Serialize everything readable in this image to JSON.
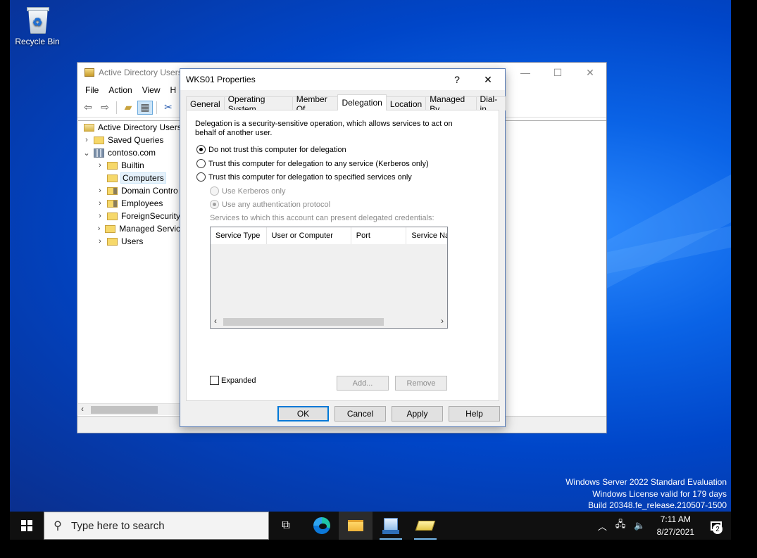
{
  "desktop": {
    "recycle_bin_label": "Recycle Bin",
    "watermark": {
      "line1": "Windows Server 2022 Standard Evaluation",
      "line2": "Windows License valid for 179 days",
      "line3": "Build 20348.fe_release.210507-1500"
    }
  },
  "aduc": {
    "title": "Active Directory Users",
    "menu": [
      "File",
      "Action",
      "View",
      "H"
    ],
    "tree": {
      "root": "Active Directory Users a",
      "saved_queries": "Saved Queries",
      "domain": "contoso.com",
      "items": [
        "Builtin",
        "Computers",
        "Domain Contro",
        "Employees",
        "ForeignSecurity",
        "Managed Servic",
        "Users"
      ]
    }
  },
  "dialog": {
    "title": "WKS01 Properties",
    "help_glyph": "?",
    "close_glyph": "✕",
    "tabs": [
      "General",
      "Operating System",
      "Member Of",
      "Delegation",
      "Location",
      "Managed By",
      "Dial-in"
    ],
    "active_tab": "Delegation",
    "description": "Delegation is a security-sensitive operation, which allows services to act on behalf of another user.",
    "options": {
      "no_trust": "Do not trust this computer for delegation",
      "trust_any": "Trust this computer for delegation to any service (Kerberos only)",
      "trust_specified": "Trust this computer for delegation to specified services only",
      "kerberos_only": "Use Kerberos only",
      "any_protocol": "Use any authentication protocol"
    },
    "selected_option": "no_trust",
    "services_label": "Services to which this account can present delegated credentials:",
    "columns": [
      "Service Type",
      "User or Computer",
      "Port",
      "Service Na"
    ],
    "expanded_label": "Expanded",
    "expanded_checked": false,
    "buttons": {
      "add": "Add...",
      "remove": "Remove",
      "ok": "OK",
      "cancel": "Cancel",
      "apply": "Apply",
      "help": "Help"
    }
  },
  "taskbar": {
    "search_placeholder": "Type here to search",
    "time": "7:11 AM",
    "date": "8/27/2021",
    "notification_count": "2"
  }
}
